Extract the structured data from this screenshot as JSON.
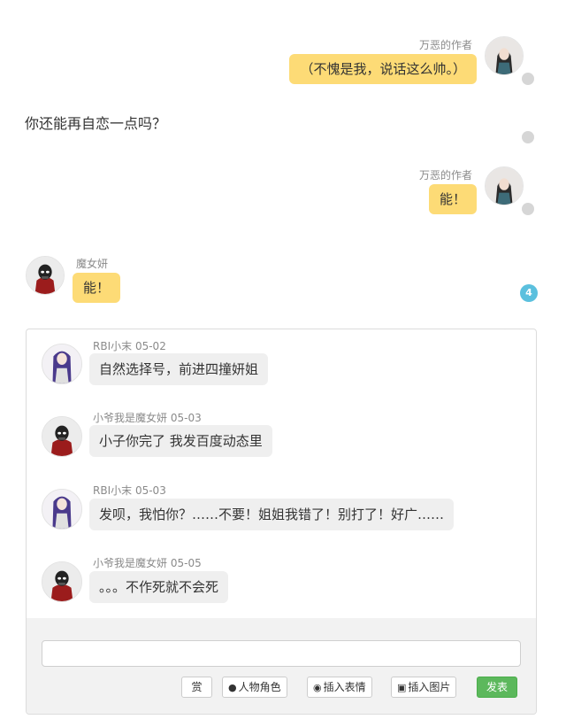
{
  "messages": [
    {
      "author": "万恶的作者",
      "text": "（不愧是我，说话这么帅。）"
    },
    {
      "narration": "你还能再自恋一点吗？"
    },
    {
      "author": "万恶的作者",
      "text": "能！"
    },
    {
      "author": "魔女妍",
      "text": "能！"
    }
  ],
  "comment_count": "4",
  "comments": [
    {
      "author": "RBI小末",
      "date": "05-02",
      "text": "自然选择号，前进四撞妍姐"
    },
    {
      "author": "小爷我是魔女妍",
      "date": "05-03",
      "text": "小子你完了 我发百度动态里"
    },
    {
      "author": "RBI小末",
      "date": "05-03",
      "text": "发呗，我怕你？……不要！姐姐我错了！别打了！好广……"
    },
    {
      "author": "小爷我是魔女妍",
      "date": "05-05",
      "text": "。。。不作死就不会死"
    }
  ],
  "reply": {
    "input_value": "",
    "buttons": {
      "reward": "赏",
      "character": "人物角色",
      "emoji": "插入表情",
      "image": "插入图片",
      "publish": "发表"
    }
  },
  "colors": {
    "bubble_yellow": "#fddb76",
    "comment_bubble": "#efefef",
    "badge": "#5bc0de",
    "publish": "#5cb85c"
  },
  "icons": [
    "author-avatar",
    "witch-avatar",
    "rbi-avatar",
    "speech-icon",
    "cat-icon",
    "picture-icon"
  ]
}
